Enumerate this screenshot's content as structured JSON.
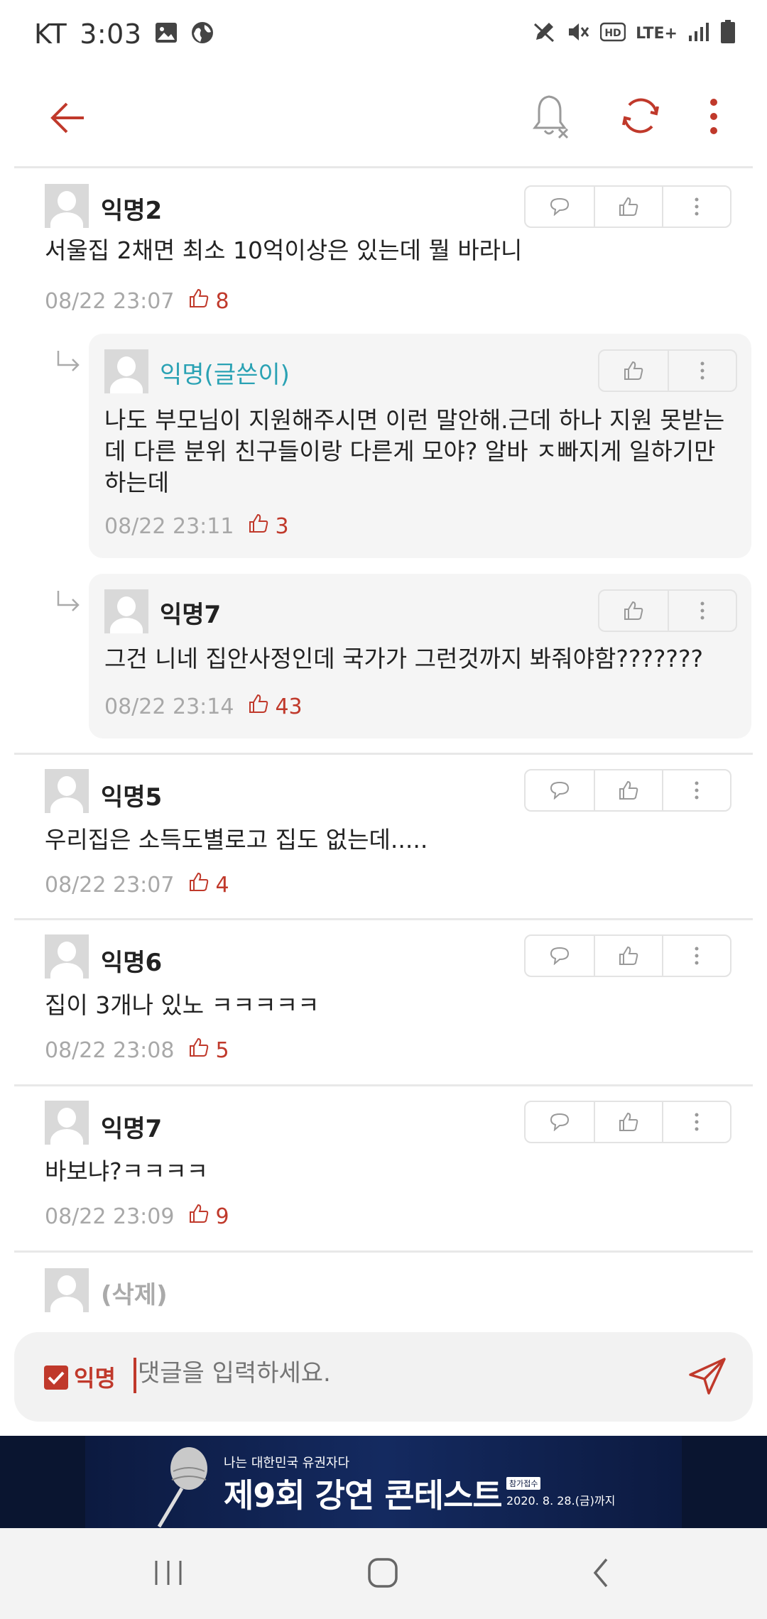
{
  "status_bar": {
    "carrier": "KT",
    "time": "3:03",
    "network": "LTE+"
  },
  "header": {
    "back_icon": "arrow-left-icon",
    "bell_icon": "bell-off-icon",
    "refresh_icon": "refresh-icon",
    "more_icon": "more-vertical-icon"
  },
  "comments": [
    {
      "name": "익명2",
      "text": "서울집 2채면 최소 10억이상은 있는데 뭘 바라니",
      "date": "08/22 23:07",
      "likes": "8"
    },
    {
      "name": "익명(글쓴이)",
      "text": "나도 부모님이 지원해주시면 이런 말안해.근데 하나 지원 못받는데 다른 분위 친구들이랑 다른게 모야? 알바 ㅈ빠지게 일하기만 하는데",
      "date": "08/22 23:11",
      "likes": "3",
      "reply": true
    },
    {
      "name": "익명7",
      "text": "그건 니네 집안사정인데 국가가 그런것까지 봐줘야함???????",
      "date": "08/22 23:14",
      "likes": "43",
      "reply": true
    },
    {
      "name": "익명5",
      "text": "우리집은 소득도별로고 집도 없는데.....",
      "date": "08/22 23:07",
      "likes": "4"
    },
    {
      "name": "익명6",
      "text": "집이 3개나 있노 ㅋㅋㅋㅋㅋ",
      "date": "08/22 23:08",
      "likes": "5"
    },
    {
      "name": "익명7",
      "text": "바보냐?ㅋㅋㅋㅋ",
      "date": "08/22 23:09",
      "likes": "9"
    },
    {
      "name": "(삭제)"
    }
  ],
  "input_bar": {
    "anonymous_label": "익명",
    "anonymous_checked": true,
    "placeholder": "댓글을 입력하세요."
  },
  "banner": {
    "subtitle": "나는 대한민국 유권자다",
    "title": "제9회 강연 콘테스트",
    "tag": "참가접수",
    "date": "2020. 8. 28.(금)까지"
  },
  "colors": {
    "accent": "#c0392b",
    "writer_name": "#2aa2b4",
    "reply_bg": "#f5f5f5"
  }
}
